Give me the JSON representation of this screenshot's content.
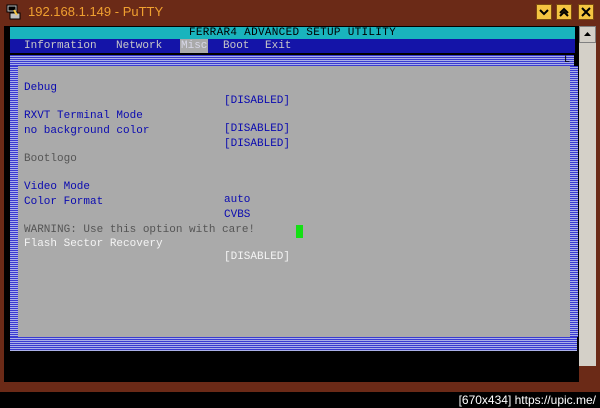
{
  "window": {
    "title": "192.168.1.149 - PuTTY"
  },
  "terminal": {
    "header": "FERRAR4  ADVANCED SETUP UTILITY",
    "menu": [
      "Information",
      "Network",
      "Misc",
      "Boot",
      "Exit"
    ],
    "active_menu": "Misc",
    "corner_char": "L",
    "rows": [
      {
        "label": "Debug",
        "value": "[DISABLED]"
      },
      {
        "label": "RXVT Terminal Mode",
        "value": "[DISABLED]"
      },
      {
        "label": "no background color",
        "value": "[DISABLED]"
      },
      {
        "label": "Bootlogo",
        "value": ""
      },
      {
        "label": "Video Mode",
        "value": "auto"
      },
      {
        "label": "Color Format",
        "value": "CVBS"
      },
      {
        "label": "WARNING: Use this option with care!",
        "value": ""
      },
      {
        "label": "Flash Sector Recovery",
        "value": "[DISABLED]"
      }
    ]
  },
  "footer": {
    "text": "[670x434] https://upic.me/"
  },
  "colors": {
    "titlebar": "#6b2a17",
    "header": "#19b4bd",
    "menu_bg": "#1414a8",
    "panel": "#aaaaaa",
    "cursor": "#14e014"
  }
}
